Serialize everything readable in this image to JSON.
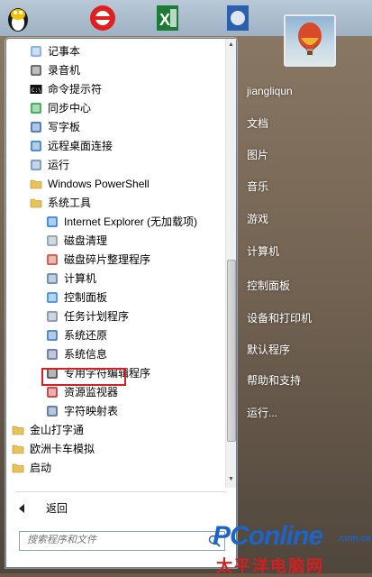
{
  "start_menu": {
    "programs": [
      {
        "label": "记事本",
        "icon": "notepad-icon",
        "indent": 1
      },
      {
        "label": "录音机",
        "icon": "microphone-icon",
        "indent": 1
      },
      {
        "label": "命令提示符",
        "icon": "cmd-icon",
        "indent": 1
      },
      {
        "label": "同步中心",
        "icon": "sync-center-icon",
        "indent": 1
      },
      {
        "label": "写字板",
        "icon": "wordpad-icon",
        "indent": 1
      },
      {
        "label": "远程桌面连接",
        "icon": "remote-desktop-icon",
        "indent": 1
      },
      {
        "label": "运行",
        "icon": "run-icon",
        "indent": 1
      },
      {
        "label": "Windows PowerShell",
        "icon": "folder-icon",
        "indent": 1
      },
      {
        "label": "系统工具",
        "icon": "folder-open-icon",
        "indent": 1
      },
      {
        "label": "Internet Explorer (无加载项)",
        "icon": "internet-explorer-icon",
        "indent": 2
      },
      {
        "label": "磁盘清理",
        "icon": "disk-cleanup-icon",
        "indent": 2
      },
      {
        "label": "磁盘碎片整理程序",
        "icon": "defragmenter-icon",
        "indent": 2
      },
      {
        "label": "计算机",
        "icon": "computer-icon",
        "indent": 2
      },
      {
        "label": "控制面板",
        "icon": "control-panel-icon",
        "indent": 2
      },
      {
        "label": "任务计划程序",
        "icon": "task-scheduler-icon",
        "indent": 2
      },
      {
        "label": "系统还原",
        "icon": "system-restore-icon",
        "indent": 2
      },
      {
        "label": "系统信息",
        "icon": "system-info-icon",
        "indent": 2
      },
      {
        "label": "专用字符编辑程序",
        "icon": "char-editor-icon",
        "indent": 2
      },
      {
        "label": "资源监视器",
        "icon": "resource-monitor-icon",
        "indent": 2
      },
      {
        "label": "字符映射表",
        "icon": "character-map-icon",
        "indent": 2
      },
      {
        "label": "金山打字通",
        "icon": "folder-icon",
        "indent": 0
      },
      {
        "label": "欧洲卡车模拟",
        "icon": "folder-icon",
        "indent": 0
      },
      {
        "label": "启动",
        "icon": "folder-icon",
        "indent": 0
      }
    ],
    "back_label": "返回",
    "search_placeholder": "搜索程序和文件"
  },
  "right_panel": {
    "user_name": "jiangliqun",
    "items": [
      "文档",
      "图片",
      "音乐",
      "游戏",
      "计算机",
      "控制面板",
      "设备和打印机",
      "默认程序",
      "帮助和支持",
      "运行..."
    ]
  },
  "watermark": {
    "brand": "PConline",
    "domain": ".com.cn",
    "cn_name": "太平洋电脑网"
  },
  "colors": {
    "highlight_border": "#d42020",
    "watermark_blue": "#1e63c6",
    "watermark_red": "#d21f1f"
  }
}
